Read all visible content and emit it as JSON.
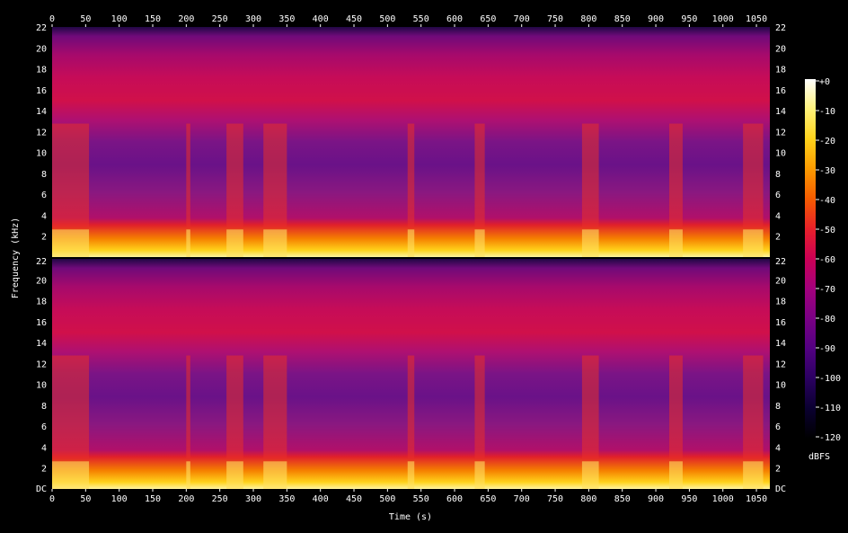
{
  "chart_data": {
    "type": "heatmap",
    "channels": 2,
    "xlabel": "Time (s)",
    "ylabel": "Frequency (kHz)",
    "x_ticks": [
      "0",
      "50",
      "100",
      "150",
      "200",
      "250",
      "300",
      "350",
      "400",
      "450",
      "500",
      "550",
      "600",
      "650",
      "700",
      "750",
      "800",
      "850",
      "900",
      "950",
      "1000",
      "1050"
    ],
    "y_ticks": [
      "2",
      "4",
      "6",
      "8",
      "10",
      "12",
      "14",
      "16",
      "18",
      "20",
      "22"
    ],
    "y_bottom_label_top": "22",
    "y_bottom_label_bottom": "DC",
    "xlim": [
      0,
      1070
    ],
    "ylim": [
      0,
      22
    ],
    "colorbar": {
      "label": "dBFS",
      "ticks": [
        "+0",
        "-10",
        "-20",
        "-30",
        "-40",
        "-50",
        "-60",
        "-70",
        "-80",
        "-90",
        "-100",
        "-110",
        "-120"
      ],
      "range": [
        -120,
        0
      ],
      "colors": [
        "#000000",
        "#0a0030",
        "#2a0060",
        "#520082",
        "#7a0085",
        "#a3007d",
        "#cc0055",
        "#e8202a",
        "#f55b00",
        "#fb9a00",
        "#ffd21a",
        "#fff27a",
        "#ffffff"
      ]
    },
    "bursts_s": [
      [
        0,
        55
      ],
      [
        200,
        206
      ],
      [
        260,
        285
      ],
      [
        315,
        350
      ],
      [
        530,
        540
      ],
      [
        630,
        645
      ],
      [
        790,
        815
      ],
      [
        920,
        940
      ],
      [
        1030,
        1060
      ]
    ],
    "grid": false
  }
}
